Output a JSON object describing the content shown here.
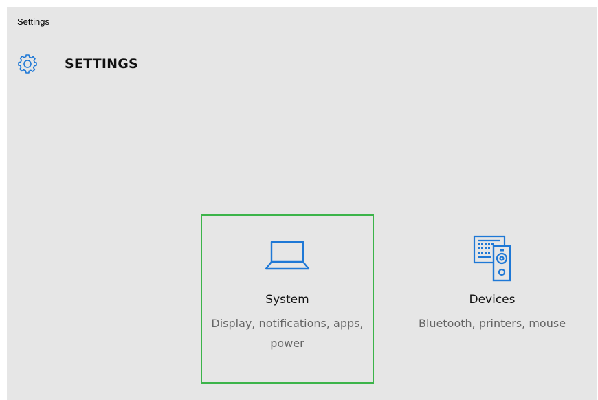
{
  "window": {
    "title": "Settings"
  },
  "header": {
    "title": "SETTINGS",
    "icon": "gear-icon"
  },
  "colors": {
    "accent": "#1e78d6",
    "selection_border": "#3cb44a",
    "background": "#e6e6e6"
  },
  "tiles": [
    {
      "title": "System",
      "description": "Display, notifications, apps, power",
      "icon": "laptop-icon",
      "selected": true
    },
    {
      "title": "Devices",
      "description": "Bluetooth, printers, mouse",
      "icon": "devices-icon",
      "selected": false
    }
  ]
}
